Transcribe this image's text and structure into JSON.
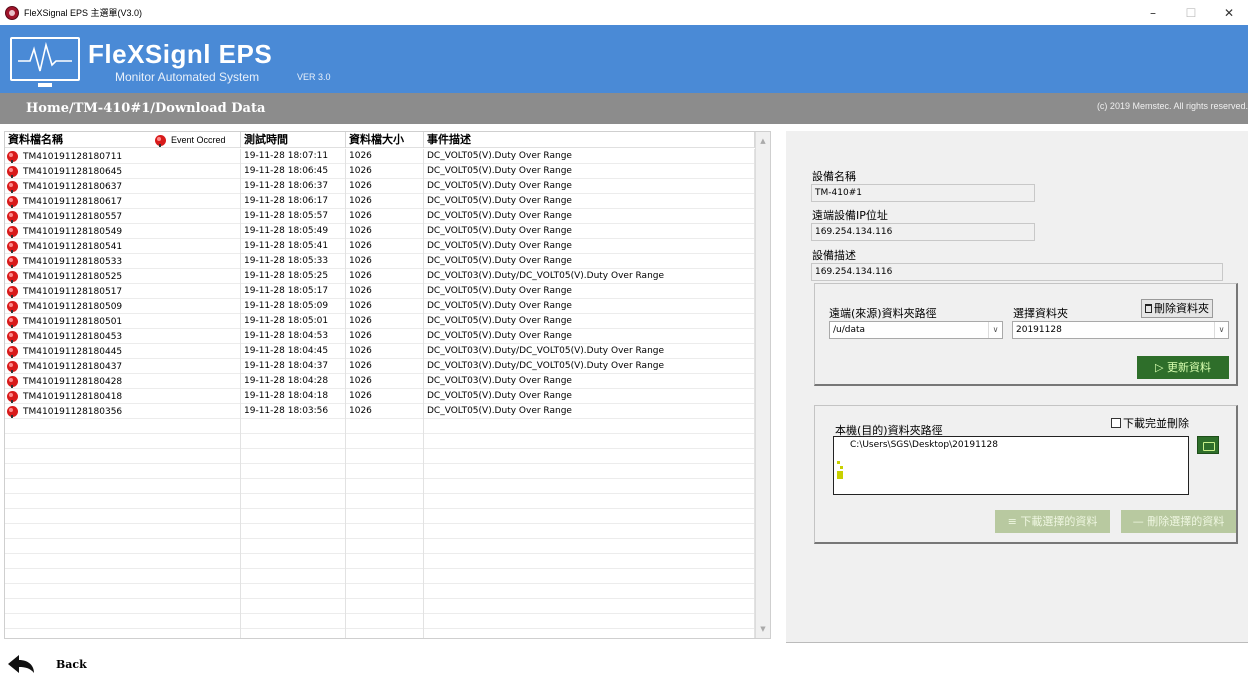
{
  "window": {
    "title": "FleXSignal EPS 主選單(V3.0)"
  },
  "header": {
    "brand": "FleXSignl EPS",
    "subtitle": "Monitor Automated System",
    "version": "VER 3.0"
  },
  "breadcrumb": {
    "path": "Home/TM-410#1/Download Data",
    "copyright": "(c) 2019 Memstec. All rights reserved."
  },
  "table": {
    "columns": {
      "name": "資料檔名稱",
      "event": "Event Occred",
      "time": "測試時間",
      "size": "資料檔大小",
      "desc": "事件描述"
    },
    "rows": [
      {
        "name": "TM410191128180711",
        "time": "19-11-28 18:07:11",
        "size": "1026",
        "desc": "DC_VOLT05(V).Duty Over Range"
      },
      {
        "name": "TM410191128180645",
        "time": "19-11-28 18:06:45",
        "size": "1026",
        "desc": "DC_VOLT05(V).Duty Over Range"
      },
      {
        "name": "TM410191128180637",
        "time": "19-11-28 18:06:37",
        "size": "1026",
        "desc": "DC_VOLT05(V).Duty Over Range"
      },
      {
        "name": "TM410191128180617",
        "time": "19-11-28 18:06:17",
        "size": "1026",
        "desc": "DC_VOLT05(V).Duty Over Range"
      },
      {
        "name": "TM410191128180557",
        "time": "19-11-28 18:05:57",
        "size": "1026",
        "desc": "DC_VOLT05(V).Duty Over Range"
      },
      {
        "name": "TM410191128180549",
        "time": "19-11-28 18:05:49",
        "size": "1026",
        "desc": "DC_VOLT05(V).Duty Over Range"
      },
      {
        "name": "TM410191128180541",
        "time": "19-11-28 18:05:41",
        "size": "1026",
        "desc": "DC_VOLT05(V).Duty Over Range"
      },
      {
        "name": "TM410191128180533",
        "time": "19-11-28 18:05:33",
        "size": "1026",
        "desc": "DC_VOLT05(V).Duty Over Range"
      },
      {
        "name": "TM410191128180525",
        "time": "19-11-28 18:05:25",
        "size": "1026",
        "desc": "DC_VOLT03(V).Duty/DC_VOLT05(V).Duty Over Range"
      },
      {
        "name": "TM410191128180517",
        "time": "19-11-28 18:05:17",
        "size": "1026",
        "desc": "DC_VOLT05(V).Duty Over Range"
      },
      {
        "name": "TM410191128180509",
        "time": "19-11-28 18:05:09",
        "size": "1026",
        "desc": "DC_VOLT05(V).Duty Over Range"
      },
      {
        "name": "TM410191128180501",
        "time": "19-11-28 18:05:01",
        "size": "1026",
        "desc": "DC_VOLT05(V).Duty Over Range"
      },
      {
        "name": "TM410191128180453",
        "time": "19-11-28 18:04:53",
        "size": "1026",
        "desc": "DC_VOLT05(V).Duty Over Range"
      },
      {
        "name": "TM410191128180445",
        "time": "19-11-28 18:04:45",
        "size": "1026",
        "desc": "DC_VOLT03(V).Duty/DC_VOLT05(V).Duty Over Range"
      },
      {
        "name": "TM410191128180437",
        "time": "19-11-28 18:04:37",
        "size": "1026",
        "desc": "DC_VOLT03(V).Duty/DC_VOLT05(V).Duty Over Range"
      },
      {
        "name": "TM410191128180428",
        "time": "19-11-28 18:04:28",
        "size": "1026",
        "desc": "DC_VOLT03(V).Duty Over Range"
      },
      {
        "name": "TM410191128180418",
        "time": "19-11-28 18:04:18",
        "size": "1026",
        "desc": "DC_VOLT05(V).Duty Over Range"
      },
      {
        "name": "TM410191128180356",
        "time": "19-11-28 18:03:56",
        "size": "1026",
        "desc": "DC_VOLT05(V).Duty Over Range"
      }
    ]
  },
  "device": {
    "name_label": "設備名稱",
    "name_value": "TM-410#1",
    "ip_label": "遠端設備IP位址",
    "ip_value": "169.254.134.116",
    "desc_label": "設備描述",
    "desc_value": "169.254.134.116"
  },
  "remote": {
    "path_label": "遠端(來源)資料夾路徑",
    "path_value": "/u/data",
    "folder_label": "選擇資料夾",
    "folder_value": "20191128",
    "delete_folder": "刪除資料夾",
    "refresh": "▷  更新資料"
  },
  "local": {
    "path_label": "本機(目的)資料夾路徑",
    "delete_after_download": "下載完並刪除",
    "path_value": "C:\\Users\\SGS\\Desktop\\20191128",
    "download_selected": "下載選擇的資料",
    "delete_selected": "刪除選擇的資料"
  },
  "nav": {
    "back": "Back"
  }
}
